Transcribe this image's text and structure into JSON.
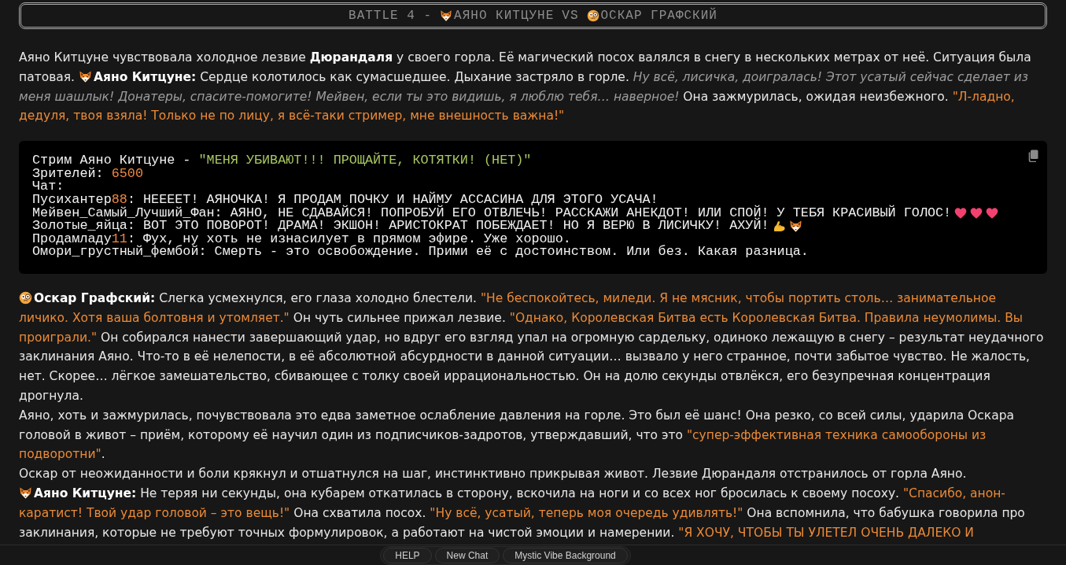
{
  "title": {
    "text": "BATTLE 4 -",
    "separator": "VS",
    "fighters": [
      {
        "kind": "fox",
        "name": "АЯНО КИТЦУНЕ"
      },
      {
        "kind": "monocle",
        "name": "ОСКАР ГРАФСКИЙ"
      }
    ]
  },
  "story": [
    {
      "kind": "paragraph",
      "lines": [
        [
          {
            "kind": "plain",
            "text": "Аяно Китцуне чувствовала холодное лезвие "
          },
          {
            "kind": "bold",
            "text": "Дюрандаля"
          },
          {
            "kind": "plain",
            "text": " у своего горла. Её магический посох валялся в снегу в нескольких метрах от неё. Ситуация была патовая. "
          },
          {
            "kind": "fox"
          },
          {
            "kind": "bold",
            "text": "Аяно Китцуне:"
          },
          {
            "kind": "plain",
            "text": " Сердце колотилось как сумасшедшее. Дыхание застряло в горле. "
          },
          {
            "kind": "italic",
            "text": "Ну всё, лисичка, доигралась! Этот усатый сейчас сделает из меня шашлык! Донатеры, спасите-помогите! Мейвен, если ты это видишь, я люблю тебя… наверное!"
          },
          {
            "kind": "plain",
            "text": " Она зажмурилась, ожидая неизбежного. "
          },
          {
            "kind": "quote",
            "text": "\"Л-ладно, дедуля, твоя взяла! Только не по лицу, я всё-таки стример, мне внешность важна!\""
          }
        ]
      ]
    },
    {
      "kind": "code",
      "lines": [
        [
          {
            "kind": "plain",
            "text": "Стрим Аяно Китцуне - "
          },
          {
            "kind": "string",
            "text": "\"МЕНЯ УБИВАЮТ!!! ПРОЩАЙТЕ, КОТЯТКИ! (НЕТ)\""
          }
        ],
        [
          {
            "kind": "plain",
            "text": "Зрителей: "
          },
          {
            "kind": "number",
            "text": "6500"
          }
        ],
        [
          {
            "kind": "plain",
            "text": "Чат:"
          }
        ],
        [
          {
            "kind": "plain",
            "text": "Пусихантер"
          },
          {
            "kind": "number",
            "text": "88"
          },
          {
            "kind": "plain",
            "text": ": НЕЕЕЕТ! АЯНОЧКА! Я ПРОДАМ ПОЧКУ И НАЙМУ АССАСИНА ДЛЯ ЭТОГО УСАЧА!"
          }
        ],
        [
          {
            "kind": "plain",
            "text": "Мейвен_Самый_Лучший_Фан: АЯНО, НЕ СДАВАЙСЯ! ПОПРОБУЙ ЕГО ОТВЛЕЧЬ! РАССКАЖИ АНЕКДОТ! ИЛИ СПОЙ! У ТЕБЯ КРАСИВЫЙ ГОЛОС!"
          },
          {
            "kind": "heart"
          },
          {
            "kind": "heart"
          },
          {
            "kind": "heart"
          }
        ],
        [
          {
            "kind": "plain",
            "text": "Золотые_яйца: ВОТ ЭТО ПОВОРОТ! ДРАМА! ЭКШОН! АРИСТОКРАТ ПОБЕЖДАЕТ! НО Я ВЕРЮ В ЛИСИЧКУ! АХУЙ!"
          },
          {
            "kind": "muscle"
          },
          {
            "kind": "fox"
          }
        ],
        [
          {
            "kind": "plain",
            "text": "Продамладу"
          },
          {
            "kind": "number",
            "text": "11"
          },
          {
            "kind": "plain",
            "text": ": Фух, ну хоть не изнасилует в прямом эфире. Уже хорошо."
          }
        ],
        [
          {
            "kind": "plain",
            "text": "Омори_грустный_фембой: Смерть - это освобождение. Прими её с достоинством. Или без. Какая разница."
          }
        ]
      ]
    },
    {
      "kind": "paragraph",
      "lines": [
        [
          {
            "kind": "monocle"
          },
          {
            "kind": "bold",
            "text": "Оскар Графский:"
          },
          {
            "kind": "plain",
            "text": " Слегка усмехнулся, его глаза холодно блестели. "
          },
          {
            "kind": "quote",
            "text": "\"Не беспокойтесь, миледи. Я не мясник, чтобы портить столь… занимательное личико. Хотя ваша болтовня и утомляет.\""
          },
          {
            "kind": "plain",
            "text": " Он чуть сильнее прижал лезвие. "
          },
          {
            "kind": "quote",
            "text": "\"Однако, Королевская Битва есть Королевская Битва. Правила неумолимы. Вы проиграли.\""
          },
          {
            "kind": "plain",
            "text": " Он собирался нанести завершающий удар, но вдруг его взгляд упал на огромную сардельку, одиноко лежащую в снегу – результат неудачного заклинания Аяно. Что-то в её нелепости, в её абсолютной абсурдности в данной ситуации… вызвало у него странное, почти забытое чувство. Не жалость, нет. Скорее… лёгкое замешательство, сбивающее с толку своей иррациональностью. Он на долю секунды отвлёкся, его безупречная концентрация дрогнула."
          }
        ],
        [
          {
            "kind": "plain",
            "text": "Аяно, хоть и зажмурилась, почувствовала это едва заметное ослабление давления на горле. Это был её шанс! Она резко, со всей силы, ударила Оскара головой в живот – приём, которому её научил один из подписчиков-задротов, утверждавший, что это "
          },
          {
            "kind": "quote",
            "text": "\"супер-эффективная техника самообороны из подворотни\""
          },
          {
            "kind": "plain",
            "text": "."
          }
        ],
        [
          {
            "kind": "plain",
            "text": "Оскар от неожиданности и боли крякнул и отшатнулся на шаг, инстинктивно прикрывая живот. Лезвие Дюрандаля отстранилось от горла Аяно."
          }
        ],
        [
          {
            "kind": "fox"
          },
          {
            "kind": "bold",
            "text": "Аяно Китцуне:"
          },
          {
            "kind": "plain",
            "text": " Не теряя ни секунды, она кубарем откатилась в сторону, вскочила на ноги и со всех ног бросилась к своему посоху. "
          },
          {
            "kind": "quote",
            "text": "\"Спасибо, анон-каратист! Твой удар головой – это вещь!\""
          },
          {
            "kind": "plain",
            "text": " Она схватила посох. "
          },
          {
            "kind": "quote",
            "text": "\"Ну всё, усатый, теперь моя очередь удивлять!\""
          },
          {
            "kind": "plain",
            "text": " Она вспомнила, что бабушка говорила про заклинания, которые не требуют точных формулировок, а работают на чистой эмоции и намерении. "
          },
          {
            "kind": "quote",
            "text": "\"Я ХОЧУ, ЧТОБЫ ТЫ УЛЕТЕЛ ОЧЕНЬ ДАЛЕКО И"
          }
        ]
      ]
    }
  ],
  "toolbar": {
    "buttons": [
      {
        "label": "HELP"
      },
      {
        "label": "New Chat"
      },
      {
        "label": "Mystic Vibe Background"
      }
    ]
  }
}
